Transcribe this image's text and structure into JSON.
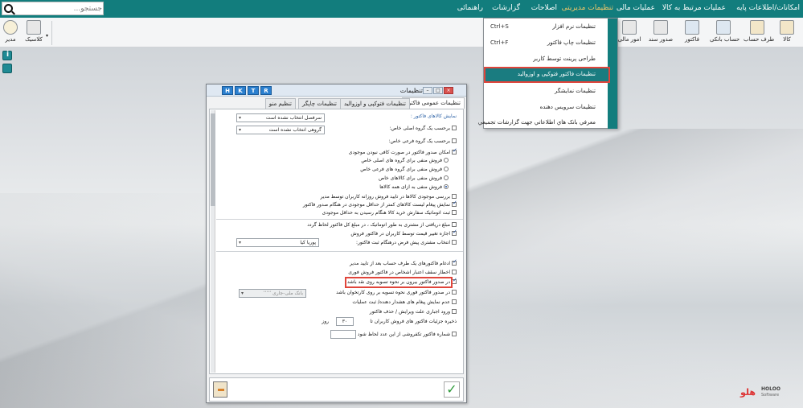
{
  "menu": {
    "items": [
      "امکانات/اطلاعات پایه",
      "عملیات مرتبط به کالا",
      "عملیات مالی",
      "تنظیمات مدیریتی",
      "اصلاحات",
      "گزارشات",
      "راهنمائی"
    ],
    "active_index": 3
  },
  "search": {
    "placeholder": "جستجو..."
  },
  "toolbar": {
    "buttons": [
      "کالا",
      "طرف حساب",
      "حساب بانکی",
      "فاکتور",
      "صدور سند",
      "امور مالی"
    ],
    "right_group": [
      "کلاسیک",
      "مدیر"
    ]
  },
  "dropdown": {
    "items": [
      {
        "label": "تنظیمات نرم افزار",
        "shortcut": "Ctrl+S"
      },
      {
        "label": "تنظیمات چاپ فاکتور",
        "shortcut": "Ctrl+F"
      },
      {
        "label": "طراحی پرینت توسط کاربر",
        "shortcut": ""
      },
      {
        "label": "تنظیمات فاکتور فتوکپی و اوزوالید",
        "shortcut": ""
      },
      {
        "label": "تنظیمات نمایشگر",
        "shortcut": ""
      },
      {
        "label": "تنظیمات سرویس دهنده",
        "shortcut": ""
      },
      {
        "label": "معرفي بانک هاي اطلاعاتي جهت گزارشات تجميعي",
        "shortcut": ""
      }
    ],
    "selected_index": 3
  },
  "dialog": {
    "title": "تنظیمات",
    "hotkeys": [
      "H",
      "K",
      "T",
      "R"
    ],
    "tabs": [
      "تنظیمات عمومی فاکتور",
      "تنظیمات فتوکپی و اوزوالید",
      "تنظیمات چاپگر",
      "تنظیم منو"
    ],
    "active_tab": 0,
    "display_label": "نمایش کالاهای فاکتور :",
    "by_main_group_label": "برحسب یک گروه اصلی خاص:",
    "by_main_group_value": "سرفصل انتخاب نشده است",
    "by_sub_group_label": "برحسب یک گروه فرعی خاص:",
    "by_sub_group_value": "گروهی انتخاب نشده است",
    "no_stock_label": "امکان صدور فاکتور در صورت کافی نبودن موجودی",
    "radios": [
      "فروش منفی برای گروه های اصلی خاص",
      "فروش منفی برای گروه های فرعی خاص",
      "فروش منفی برای کالاهای خاص",
      "فروش منفی به ازای همه کالاها"
    ],
    "checks_a": [
      {
        "label": "بررسی موجودی کالاها در تایید فروش روزانه کاربران توسط مدیر",
        "checked": false
      },
      {
        "label": "نمایش پیغام لیست کالاهای کمتر از حداقل موجودی در هنگام صدور فاکتور",
        "checked": true
      },
      {
        "label": "ثبت اتوماتیک سفارش خرید کالا هنگام رسیدن به حداقل موجودی",
        "checked": false
      }
    ],
    "checks_b": [
      {
        "label": "مبلغ دریافتی از مشتری به طور اتوماتیک ، در مبلغ کل فاکتور لحاظ گردد",
        "checked": false
      },
      {
        "label": "اجازه تغییر قیمت توسط کاربران در فاکتور فروش",
        "checked": true
      },
      {
        "label": "انتخاب مشتری پیش فرض درهنگام ثبت فاکتور:",
        "checked": false
      }
    ],
    "default_customer": "پوریا کیا",
    "checks_c": [
      {
        "label": "ادغام فاکتورهای یک طرف حساب بعد از تایید مدیر",
        "checked": true
      },
      {
        "label": "اخطار سقف اعتبار اشخاص در فاکتور فروش فوری",
        "checked": false
      },
      {
        "label": "در صدور فاکتور بیرون بر نحوه تسویه روی نقد باشد",
        "checked": true
      },
      {
        "label": "در صدور فاکتور فوری نحوه تسویه بر روی کارتخوان باشد",
        "checked": false
      },
      {
        "label": "عدم نمایش پیغام های هشدار دهنده/ ثبت عملیات",
        "checked": false
      },
      {
        "label": "ورود اجباری علت ویرایش / حذف فاکتور",
        "checked": false
      }
    ],
    "card_reader_value": "بانک ملی-جاری ٬٬٬٬٬",
    "save_days_label": "ذخیره جزئیات فاکتور های فروش کاربران تا",
    "save_days_value": "۳۰",
    "days_unit": "روز",
    "invoice_number_label": "شماره فاکتور تکفروشی از این عدد لحاظ شود"
  },
  "brand": {
    "name": "HOLOO",
    "sub": "Software"
  }
}
